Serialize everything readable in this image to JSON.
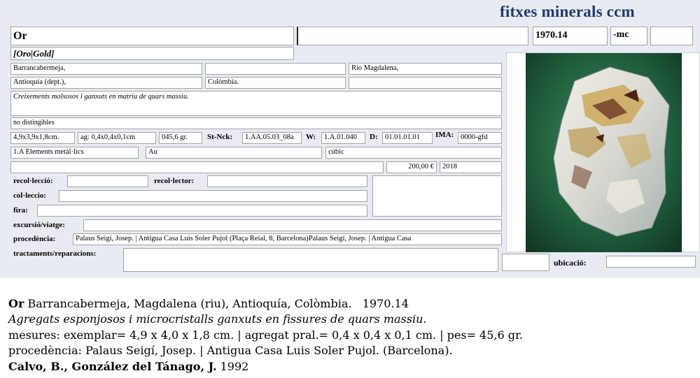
{
  "header": {
    "brand": "fitxes minerals ccm"
  },
  "card": {
    "name": "Or",
    "name_extra": "",
    "catalog_number": "1970.14",
    "suffix": "-mc",
    "extra_code": "",
    "synonyms": "[Oro|Gold]",
    "locality": "Barrancabermeja,",
    "locality_2": "",
    "river": "Río Magdalena,",
    "region": "Antioquía (dept.),",
    "country": "Colòmbia.",
    "region_extra": "",
    "description": "Creixements molsosos i ganxuts en matriu de quars massiu.",
    "notes": "no distingibles",
    "size": "4,9x3,9x1,8cm.",
    "aggregate": "ag: 0,4x0,4x0,1cm",
    "weight": "045,6 gr.",
    "st_nck_label": "St-Nck:",
    "st_nck": "1.AA.05.03_08a",
    "w_label": "W:",
    "w": "1.A.01.040",
    "d_label": "D:",
    "d": "01.01.01.01",
    "ima_label": "IMA:",
    "ima": "0000-gfd",
    "class": "1.A Elements metàl·lics",
    "formula": "Au",
    "system": "cúbic",
    "price": "200,00 €",
    "year": "2018",
    "recoleccio_label": "recol·lecció:",
    "recoleccio": "",
    "recolector_label": "recol·lector:",
    "recolector": "",
    "colleccio_label": "col·leccio:",
    "colleccio": "",
    "fira_label": "fira:",
    "fira": "",
    "excursio_label": "excursió/viatge:",
    "excursio": "",
    "procedencia_label": "procedència:",
    "procedencia": "Palaus Seigí, Josep. | Antigua Casa Luis Soler Pujol (Plaça Reial, 8, Barcelona)Palaus Seigí, Josep. | Antigua Casa",
    "tractaments_label": "tractaments/reparacions:",
    "tractaments": "",
    "ubicacio_label": "ubicació:",
    "ubicacio": ""
  },
  "summary": {
    "name": "Or",
    "locality": "Barrancabermeja, Magdalena (riu), Antioquía, Colòmbia.",
    "number": "1970.14",
    "description": "Agregats esponjosos i microcristalls ganxuts en fissures de quars massiu.",
    "measures": "mesures: exemplar= 4,9 x 4,0 x 1,8 cm. | agregat pral.= 0,4 x 0,4 x 0,1 cm. | pes= 45,6 gr.",
    "provenance": "procedència: Palaus Seigí, Josep. | Antigua Casa Luis Soler Pujol. (Barcelona).",
    "authors": "Calvo, B., González del Tánago, J.",
    "year": "1992"
  },
  "photo": {
    "icon": "mineral-specimen-photo",
    "background": "#1e5a3e",
    "quartz": "#dcd8cc",
    "gold": "#c9a24a",
    "oxide": "#6b3a26"
  }
}
